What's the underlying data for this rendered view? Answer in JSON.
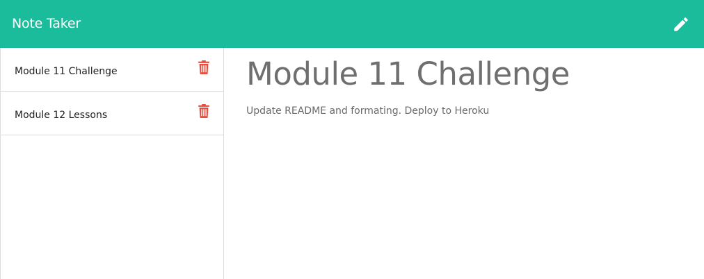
{
  "navbar": {
    "brand": "Note Taker",
    "new_note_icon": "pencil-icon"
  },
  "colors": {
    "navbar_bg": "#1abc9c",
    "delete_icon": "#e74c3c",
    "title_text": "#6f6f6f"
  },
  "sidebar": {
    "notes": [
      {
        "title": "Module 11 Challenge",
        "delete_icon": "trash-icon"
      },
      {
        "title": "Module 12 Lessons",
        "delete_icon": "trash-icon"
      }
    ]
  },
  "editor": {
    "title": "Module 11 Challenge",
    "body": "Update README and formating. Deploy to Heroku"
  }
}
